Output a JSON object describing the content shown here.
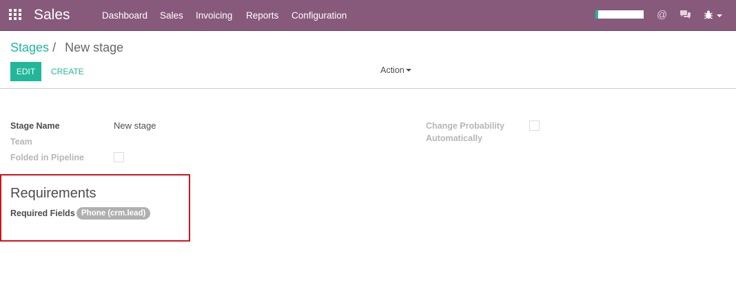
{
  "navbar": {
    "app_title": "Sales",
    "menu": [
      "Dashboard",
      "Sales",
      "Invoicing",
      "Reports",
      "Configuration"
    ],
    "progress_fraction": 0.05,
    "at_symbol": "@",
    "colors": {
      "bar": "#875a7b",
      "accent": "#21b799"
    }
  },
  "breadcrumb": {
    "parent": "Stages",
    "separator": "/",
    "current": "New stage"
  },
  "toolbar": {
    "edit_label": "EDIT",
    "create_label": "CREATE",
    "action_label": "Action"
  },
  "form": {
    "stage_name_label": "Stage Name",
    "stage_name_value": "New stage",
    "team_label": "Team",
    "folded_label": "Folded in Pipeline",
    "folded_checked": false,
    "change_prob_label_line1": "Change Probability",
    "change_prob_label_line2": "Automatically",
    "change_prob_checked": false,
    "requirements_title": "Requirements",
    "required_fields_label": "Required Fields",
    "required_fields_tags": [
      "Phone (crm.lead)"
    ]
  }
}
